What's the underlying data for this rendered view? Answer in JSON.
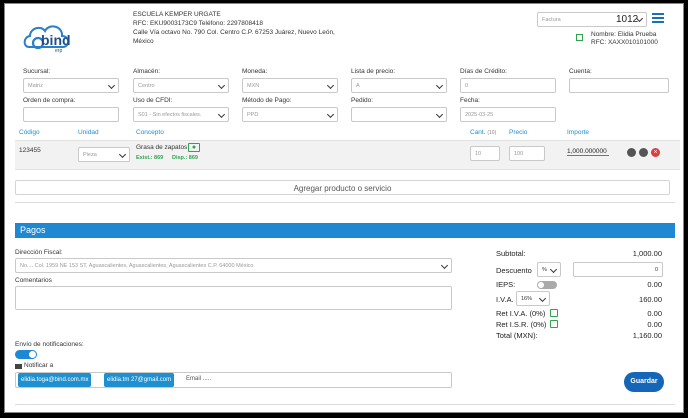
{
  "company": {
    "name": "ESCUELA KEMPER URGATE",
    "rfc_phone": "RFC: EKU9003173C9 Teléfono: 2297808418",
    "address1": "Calle Vía octavo No. 790 Col. Centro C.P. 67253 Juárez, Nuevo León,",
    "address2": "México",
    "logo_text": "bind",
    "logo_sub": "erp"
  },
  "doc": {
    "type_value": "Factura",
    "number": "1012",
    "client_name": "Nombre: Elidia Prueba",
    "client_rfc": "RFC: XAXX010101000"
  },
  "form": {
    "sucursal": {
      "label": "Sucursal:",
      "value": "Matriz"
    },
    "almacen": {
      "label": "Almacén:",
      "value": "Centro"
    },
    "moneda": {
      "label": "Moneda:",
      "value": "MXN"
    },
    "lista": {
      "label": "Lista de precio:",
      "value": "A"
    },
    "dias": {
      "label": "Días de Crédito:",
      "value": "0"
    },
    "cuenta": {
      "label": "Cuenta:",
      "value": ""
    },
    "orden": {
      "label": "Orden de compra:",
      "value": ""
    },
    "cfdi": {
      "label": "Uso de CFDI:",
      "value": "S01 - Sin efectos fiscales."
    },
    "metodo": {
      "label": "Método de Pago:",
      "value": "PPD"
    },
    "pedido": {
      "label": "Pedido:",
      "value": ""
    },
    "fecha": {
      "label": "Fecha:",
      "value": "2025-03-25"
    }
  },
  "table": {
    "headers": {
      "codigo": "Código",
      "unidad": "Unidad",
      "concepto": "Concepto",
      "cant": "Cant.",
      "cant_unit": "(10)",
      "precio": "Precio",
      "importe": "Importe"
    },
    "row": {
      "codigo": "123455",
      "unidad": "Pieza",
      "concepto": "Grasa de zapatos",
      "exist": "Exist.: 869",
      "disp": "Disp.: 869",
      "cant": "10",
      "precio": "100",
      "importe": "1,000.000000"
    },
    "add_label": "Agregar producto o servicio"
  },
  "pagos": {
    "title": "Pagos",
    "dir_label": "Dirección Fiscal:",
    "dir_value": "No.... Col. 1959 NE 153 ST, Aguascalientes, Aguascalientes, Aguascalientes C.P. 64000 México",
    "comentarios_label": "Comentarios",
    "envio_label": "Envío de notificaciones:",
    "notificar_label": "Notificar a",
    "email_placeholder": "Email .....",
    "emails": [
      "elidia.toga@bind.com.mx",
      "elidia.tm 27@gmail.com"
    ],
    "guardar": "Guardar"
  },
  "summary": {
    "subtotal_label": "Subtotal:",
    "subtotal": "1,000.00",
    "descuento_label": "Descuento",
    "descuento_type": "%",
    "descuento_value": "0",
    "ieps_label": "IEPS:",
    "ieps": "0.00",
    "iva_label": "I.V.A.",
    "iva_rate": "16%",
    "iva": "160.00",
    "ret_iva_label": "Ret I.V.A. (0%)",
    "ret_iva": "0.00",
    "ret_isr_label": "Ret I.S.R. (0%)",
    "ret_isr": "0.00",
    "total_label": "Total (MXN):",
    "total": "1,160.00"
  },
  "colors": {
    "accent": "#1b8fd6",
    "bar": "#1e88d2",
    "danger": "#e23b3b",
    "success": "#2ea44f"
  }
}
